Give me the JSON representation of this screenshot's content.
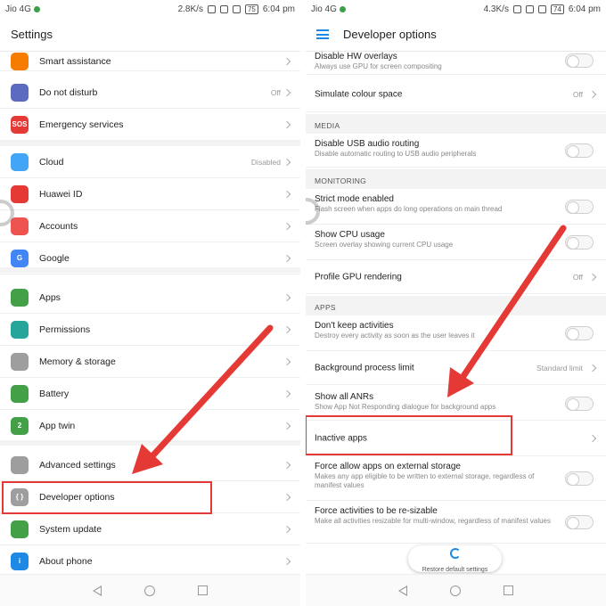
{
  "left": {
    "status": {
      "carrier": "Jio 4G",
      "speed": "2.8K/s",
      "battery": "75",
      "time": "6:04 pm"
    },
    "title": "Settings",
    "rows": [
      {
        "label": "Smart assistance",
        "value": "",
        "icon": "hand-icon",
        "color": "#f57c00"
      },
      {
        "label": "Do not disturb",
        "value": "Off",
        "icon": "moon-icon",
        "color": "#5c6bc0"
      },
      {
        "label": "Emergency services",
        "value": "",
        "icon": "sos-icon",
        "color": "#e53935",
        "glyph": "SOS"
      },
      {
        "label": "Cloud",
        "value": "Disabled",
        "icon": "cloud-icon",
        "color": "#42a5f5"
      },
      {
        "label": "Huawei ID",
        "value": "",
        "icon": "huawei-icon",
        "color": "#e53935"
      },
      {
        "label": "Accounts",
        "value": "",
        "icon": "account-icon",
        "color": "#ef5350"
      },
      {
        "label": "Google",
        "value": "",
        "icon": "google-icon",
        "color": "#4285f4",
        "glyph": "G"
      },
      {
        "label": "Apps",
        "value": "",
        "icon": "apps-icon",
        "color": "#43a047"
      },
      {
        "label": "Permissions",
        "value": "",
        "icon": "key-icon",
        "color": "#26a69a"
      },
      {
        "label": "Memory & storage",
        "value": "",
        "icon": "storage-icon",
        "color": "#9e9e9e"
      },
      {
        "label": "Battery",
        "value": "",
        "icon": "battery-icon",
        "color": "#43a047"
      },
      {
        "label": "App twin",
        "value": "",
        "icon": "app-twin-icon",
        "color": "#43a047",
        "glyph": "2"
      },
      {
        "label": "Advanced settings",
        "value": "",
        "icon": "gear-icon",
        "color": "#9e9e9e"
      },
      {
        "label": "Developer options",
        "value": "",
        "icon": "braces-icon",
        "color": "#9e9e9e",
        "glyph": "{ }"
      },
      {
        "label": "System update",
        "value": "",
        "icon": "update-icon",
        "color": "#43a047"
      },
      {
        "label": "About phone",
        "value": "",
        "icon": "info-icon",
        "color": "#1e88e5",
        "glyph": "i"
      }
    ]
  },
  "right": {
    "status": {
      "carrier": "Jio 4G",
      "speed": "4.3K/s",
      "battery": "74",
      "time": "6:04 pm"
    },
    "title": "Developer options",
    "rows": [
      {
        "kind": "toggle",
        "label": "Disable HW overlays",
        "sub": "Always use GPU for screen compositing"
      },
      {
        "kind": "value",
        "label": "Simulate colour space",
        "value": "Off"
      },
      {
        "kind": "section",
        "label": "MEDIA"
      },
      {
        "kind": "toggle",
        "label": "Disable USB audio routing",
        "sub": "Disable automatic routing to USB audio peripherals"
      },
      {
        "kind": "section",
        "label": "MONITORING"
      },
      {
        "kind": "toggle",
        "label": "Strict mode enabled",
        "sub": "Flash screen when apps do long operations on main thread"
      },
      {
        "kind": "toggle",
        "label": "Show CPU usage",
        "sub": "Screen overlay showing current CPU usage"
      },
      {
        "kind": "value",
        "label": "Profile GPU rendering",
        "value": "Off"
      },
      {
        "kind": "section",
        "label": "APPS"
      },
      {
        "kind": "toggle",
        "label": "Don't keep activities",
        "sub": "Destroy every activity as soon as the user leaves it"
      },
      {
        "kind": "value",
        "label": "Background process limit",
        "value": "Standard limit"
      },
      {
        "kind": "toggle",
        "label": "Show all ANRs",
        "sub": "Show App Not Responding dialogue for background apps"
      },
      {
        "kind": "value",
        "label": "Inactive apps",
        "value": ""
      },
      {
        "kind": "toggle",
        "label": "Force allow apps on external storage",
        "sub": "Makes any app eligible to be written to external storage, regardless of manifest values"
      },
      {
        "kind": "toggle",
        "label": "Force activities to be re-sizable",
        "sub": "Make all activities resizable for multi-window, regardless of manifest values"
      }
    ],
    "restore_label": "Restore default settings"
  }
}
